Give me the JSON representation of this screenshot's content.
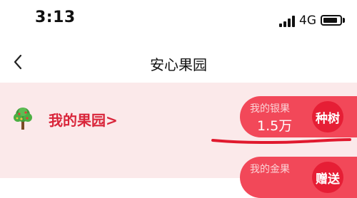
{
  "status_bar": {
    "time": "3:13",
    "network": "4G"
  },
  "header": {
    "back_icon": "chevron-left-icon",
    "title": "安心果园"
  },
  "garden": {
    "icon": "tree-icon",
    "link_label": "我的果园>"
  },
  "silver_fruit": {
    "caption": "我的银果",
    "value": "1.5万",
    "action_label": "种树"
  },
  "gold_fruit": {
    "caption": "我的金果",
    "action_label": "赠送"
  },
  "colors": {
    "accent": "#e61e35",
    "pill": "#f24859",
    "garden_text": "#d9253a",
    "content_bg": "#fbe9ea",
    "annotation_stroke": "#e0192e"
  }
}
